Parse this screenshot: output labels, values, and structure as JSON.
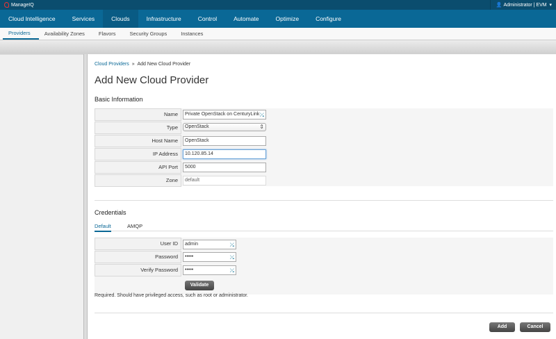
{
  "app": {
    "logo": "ManageIQ",
    "user": "Administrator | EVM"
  },
  "nav": [
    "Cloud Intelligence",
    "Services",
    "Clouds",
    "Infrastructure",
    "Control",
    "Automate",
    "Optimize",
    "Configure"
  ],
  "subnav": [
    "Providers",
    "Availability Zones",
    "Flavors",
    "Security Groups",
    "Instances"
  ],
  "breadcrumb": {
    "parent": "Cloud Providers",
    "sep": "»",
    "current": "Add New Cloud Provider"
  },
  "title": "Add New Cloud Provider",
  "basic": {
    "heading": "Basic Information",
    "fields": [
      {
        "label": "Name",
        "value": "Private OpenStack on CenturyLink"
      },
      {
        "label": "Type",
        "value": "OpenStack"
      },
      {
        "label": "Host Name",
        "value": "OpenStack"
      },
      {
        "label": "IP Address",
        "value": "10.120.85.14"
      },
      {
        "label": "API Port",
        "value": "5000"
      },
      {
        "label": "Zone",
        "value": "default"
      }
    ]
  },
  "credentials": {
    "heading": "Credentials",
    "tabs": [
      "Default",
      "AMQP"
    ],
    "fields": [
      {
        "label": "User ID",
        "value": "admin"
      },
      {
        "label": "Password",
        "value": "•••••"
      },
      {
        "label": "Verify Password",
        "value": "•••••"
      }
    ],
    "validate": "Validate",
    "note": "Required. Should have privileged access, such as root or administrator."
  },
  "actions": {
    "add": "Add",
    "cancel": "Cancel"
  }
}
